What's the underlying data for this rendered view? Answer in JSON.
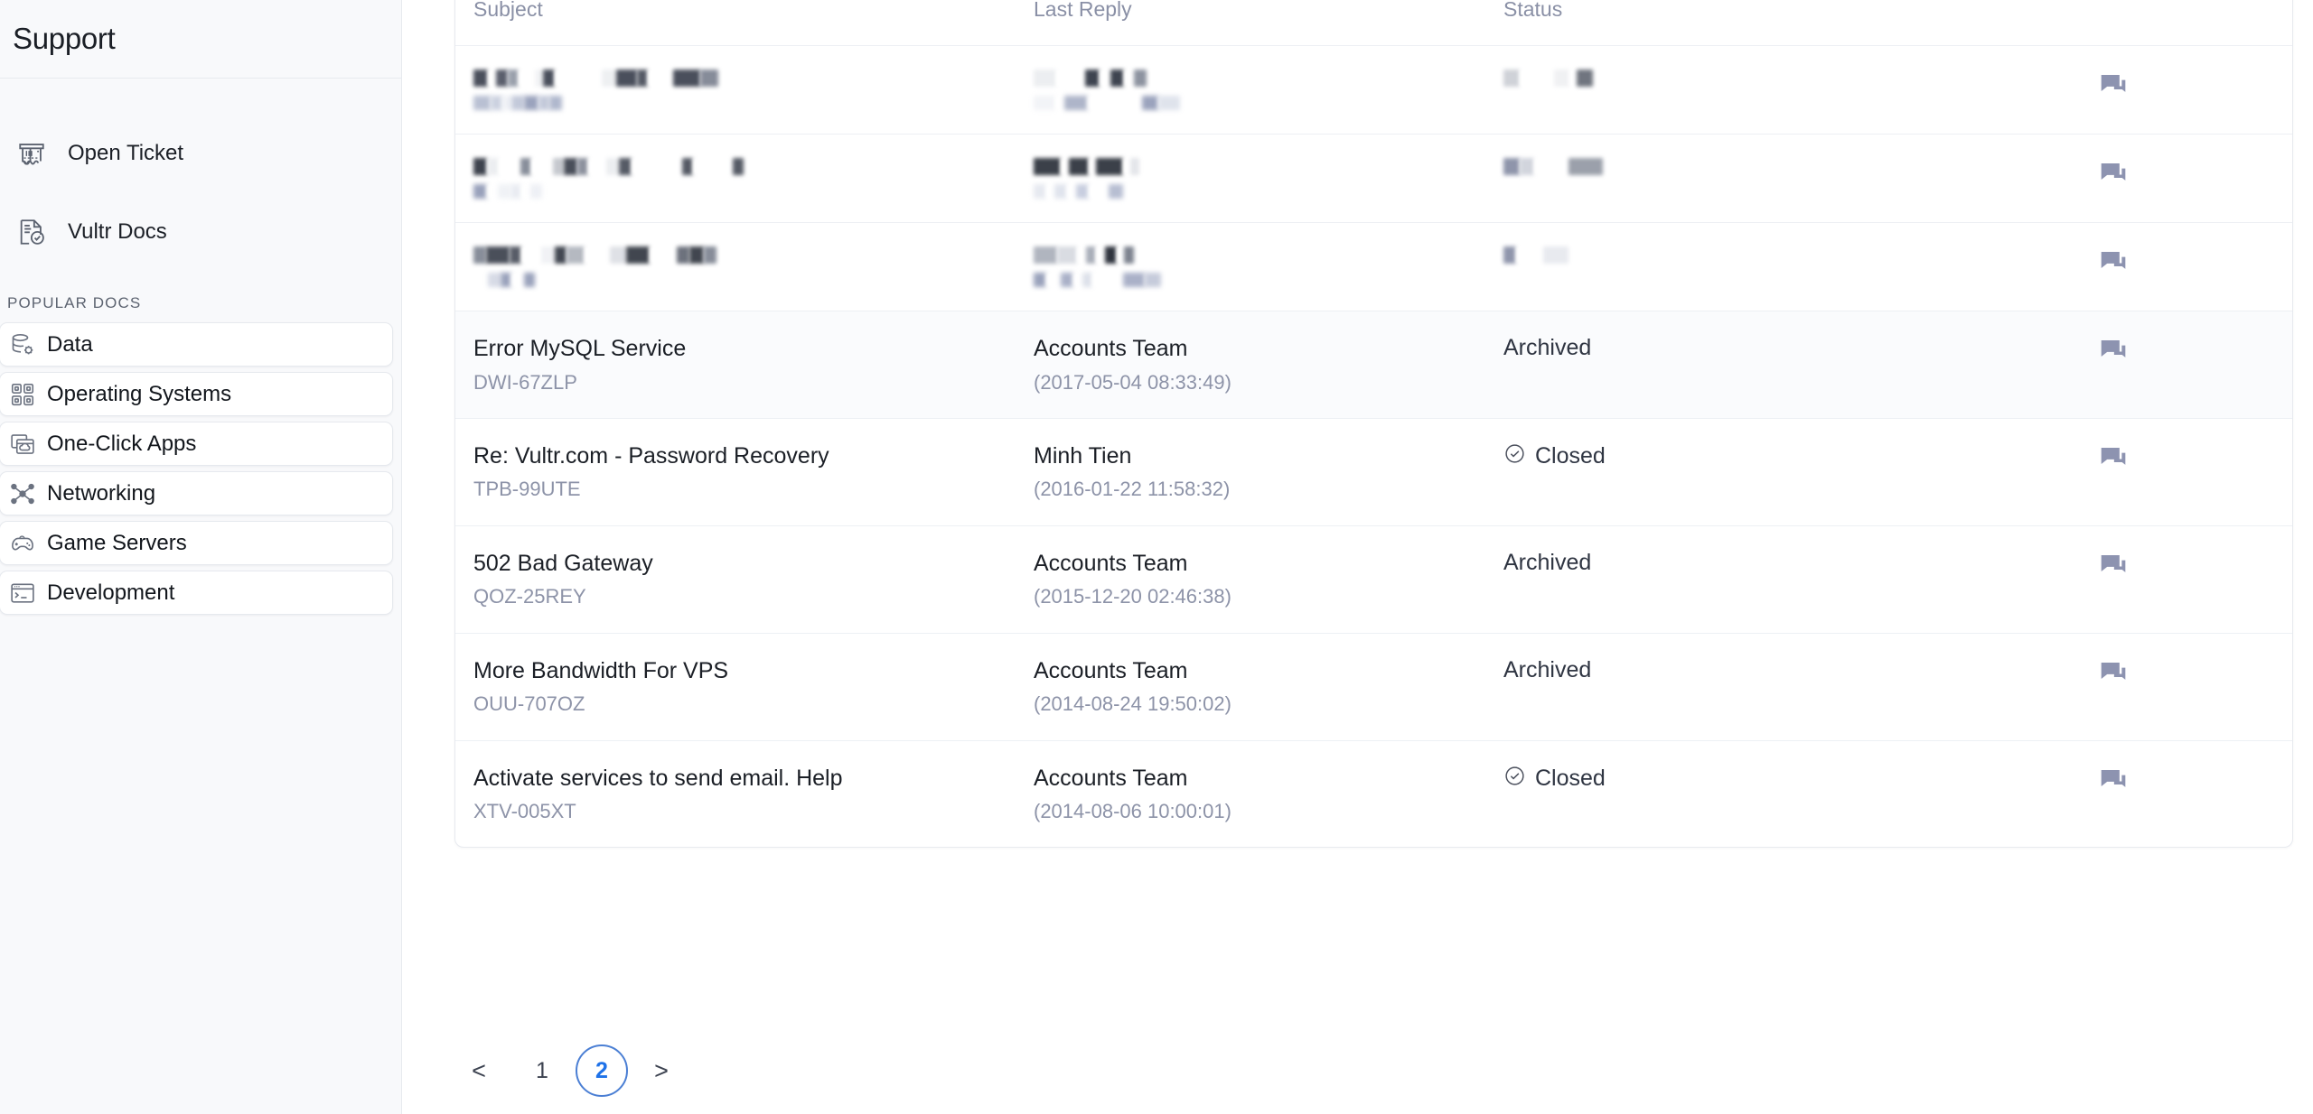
{
  "sidebar": {
    "title": "Support",
    "links": [
      {
        "label": "Open Ticket",
        "icon": "ticket-icon"
      },
      {
        "label": "Vultr Docs",
        "icon": "document-check-icon"
      }
    ],
    "section_label": "POPULAR DOCS",
    "docs": [
      {
        "label": "Data",
        "icon": "database-gear-icon"
      },
      {
        "label": "Operating Systems",
        "icon": "grid-squares-icon"
      },
      {
        "label": "One-Click Apps",
        "icon": "cloud-windows-icon"
      },
      {
        "label": "Networking",
        "icon": "network-nodes-icon"
      },
      {
        "label": "Game Servers",
        "icon": "gamepad-icon"
      },
      {
        "label": "Development",
        "icon": "terminal-icon"
      }
    ]
  },
  "table": {
    "columns": {
      "subject": "Subject",
      "last_reply": "Last Reply",
      "status": "Status",
      "action": ""
    },
    "rows": [
      {
        "redacted": true,
        "subject": "",
        "ticket_id": "",
        "reply_by": "",
        "reply_time": "",
        "status": "",
        "action_icon": "chat-bubbles-icon"
      },
      {
        "redacted": true,
        "subject": "",
        "ticket_id": "",
        "reply_by": "",
        "reply_time": "",
        "status": "",
        "action_icon": "chat-bubbles-icon"
      },
      {
        "redacted": true,
        "subject": "",
        "ticket_id": "",
        "reply_by": "",
        "reply_time": "",
        "status": "",
        "action_icon": "chat-bubbles-icon"
      },
      {
        "redacted": false,
        "subject": "Error MySQL Service",
        "ticket_id": "DWI-67ZLP",
        "reply_by": "Accounts Team",
        "reply_time": "(2017-05-04 08:33:49)",
        "status": "Archived",
        "status_has_check": false,
        "action_icon": "chat-bubbles-icon"
      },
      {
        "redacted": false,
        "subject": "Re: Vultr.com - Password Recovery",
        "ticket_id": "TPB-99UTE",
        "reply_by": "Minh Tien",
        "reply_time": "(2016-01-22 11:58:32)",
        "status": "Closed",
        "status_has_check": true,
        "action_icon": "chat-bubbles-icon"
      },
      {
        "redacted": false,
        "subject": "502 Bad Gateway",
        "ticket_id": "QOZ-25REY",
        "reply_by": "Accounts Team",
        "reply_time": "(2015-12-20 02:46:38)",
        "status": "Archived",
        "status_has_check": false,
        "action_icon": "chat-bubbles-icon"
      },
      {
        "redacted": false,
        "subject": "More Bandwidth For VPS",
        "ticket_id": "OUU-707OZ",
        "reply_by": "Accounts Team",
        "reply_time": "(2014-08-24 19:50:02)",
        "status": "Archived",
        "status_has_check": false,
        "action_icon": "chat-bubbles-icon"
      },
      {
        "redacted": false,
        "subject": "Activate services to send email. Help",
        "ticket_id": "XTV-005XT",
        "reply_by": "Accounts Team",
        "reply_time": "(2014-08-06 10:00:01)",
        "status": "Closed",
        "status_has_check": true,
        "action_icon": "chat-bubbles-icon"
      }
    ]
  },
  "pagination": {
    "prev": "<",
    "next": ">",
    "pages": [
      "1",
      "2"
    ],
    "current_page": "2"
  },
  "colors": {
    "accent": "#1f72e8",
    "accent_ring": "#4b7fd4",
    "icon_muted": "#8d93a8",
    "text_primary": "#1b1f26",
    "text_muted": "#8a90a6",
    "row_alt_bg": "#fafbfd",
    "sidebar_bg": "#f8f9fb",
    "border": "#e7eaef"
  }
}
